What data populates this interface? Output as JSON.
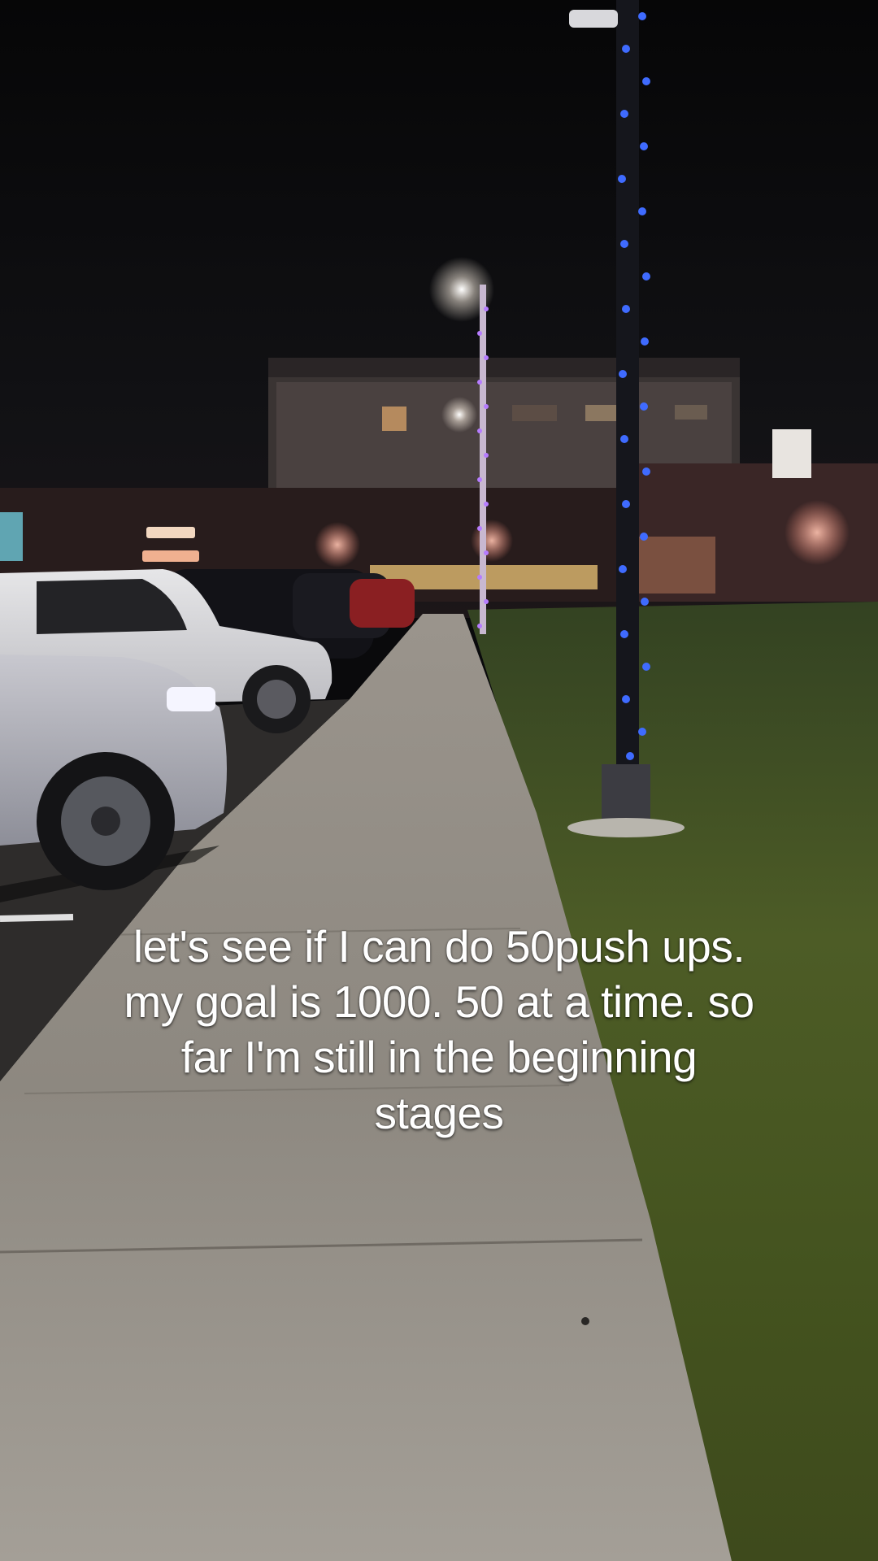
{
  "caption": {
    "lines": [
      "let's see if I can do 50push ups.",
      "my goal is 1000. 50 at a time. so",
      "far I'm still in the beginning",
      "stages"
    ]
  },
  "scene": {
    "colors": {
      "sky": "#0a0a0c",
      "sidewalk": "#8e8a82",
      "grass": "#4a5a24",
      "pole_lights": "#3f6bff",
      "purple_lights": "#b67cff"
    }
  }
}
